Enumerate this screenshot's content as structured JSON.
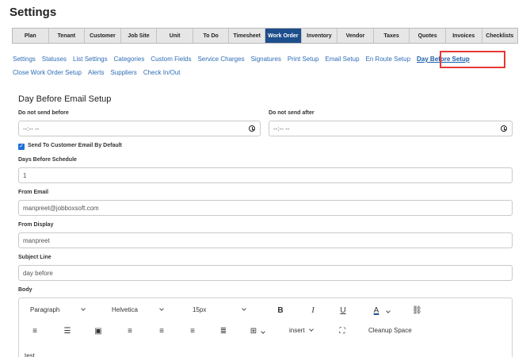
{
  "page": {
    "title": "Settings"
  },
  "top_tabs": [
    "Plan",
    "Tenant",
    "Customer",
    "Job Site",
    "Unit",
    "To Do",
    "Timesheet",
    "Work Order",
    "Inventory",
    "Vendor",
    "Taxes",
    "Quotes",
    "Invoices",
    "Checklists"
  ],
  "active_tab": "Work Order",
  "sub_nav": {
    "row1": [
      "Settings",
      "Statuses",
      "List Settings",
      "Categories",
      "Custom Fields",
      "Service Charges",
      "Signatures",
      "Print Setup",
      "Email Setup",
      "En Route Setup",
      "Day Before Setup"
    ],
    "row2": [
      "Close Work Order Setup",
      "Alerts",
      "Suppliers",
      "Check In/Out"
    ],
    "active": "Day Before Setup"
  },
  "form": {
    "title": "Day Before Email Setup",
    "not_before_label": "Do not send before",
    "not_before_value": "--:-- --",
    "not_after_label": "Do not send after",
    "not_after_value": "--:-- --",
    "send_to_customer_label": "Send To Customer Email By Default",
    "send_to_customer_checked": true,
    "days_label": "Days Before Schedule",
    "days_value": "1",
    "from_email_label": "From Email",
    "from_email_value": "manpreet@jobboxsoft.com",
    "from_display_label": "From Display",
    "from_display_value": "manpreet",
    "subject_label": "Subject Line",
    "subject_value": "day before",
    "body_label": "Body"
  },
  "editor": {
    "paragraph": "Paragraph",
    "font": "Helvetica",
    "size": "15px",
    "insert": "insert",
    "cleanup": "Cleanup Space",
    "text_color_glyph": "A",
    "bold_glyph": "B",
    "italic_glyph": "I",
    "underline_glyph": "U",
    "body_text": "test"
  },
  "icons": {
    "link": "link-icon",
    "ordered_list": "ordered-list-icon",
    "unordered_list": "unordered-list-icon",
    "image": "image-icon",
    "align_left": "align-left-icon",
    "align_right": "align-right-icon",
    "align_center": "align-center-icon",
    "justify": "justify-icon",
    "table": "table-icon",
    "fullscreen": "fullscreen-icon",
    "clock": "clock-icon",
    "checkbox_checked": "checkmark-icon"
  },
  "colors": {
    "active_tab": "#1e4e8c",
    "link": "#2f6db5",
    "highlight": "#e53935",
    "checkbox": "#1e6fd9"
  }
}
